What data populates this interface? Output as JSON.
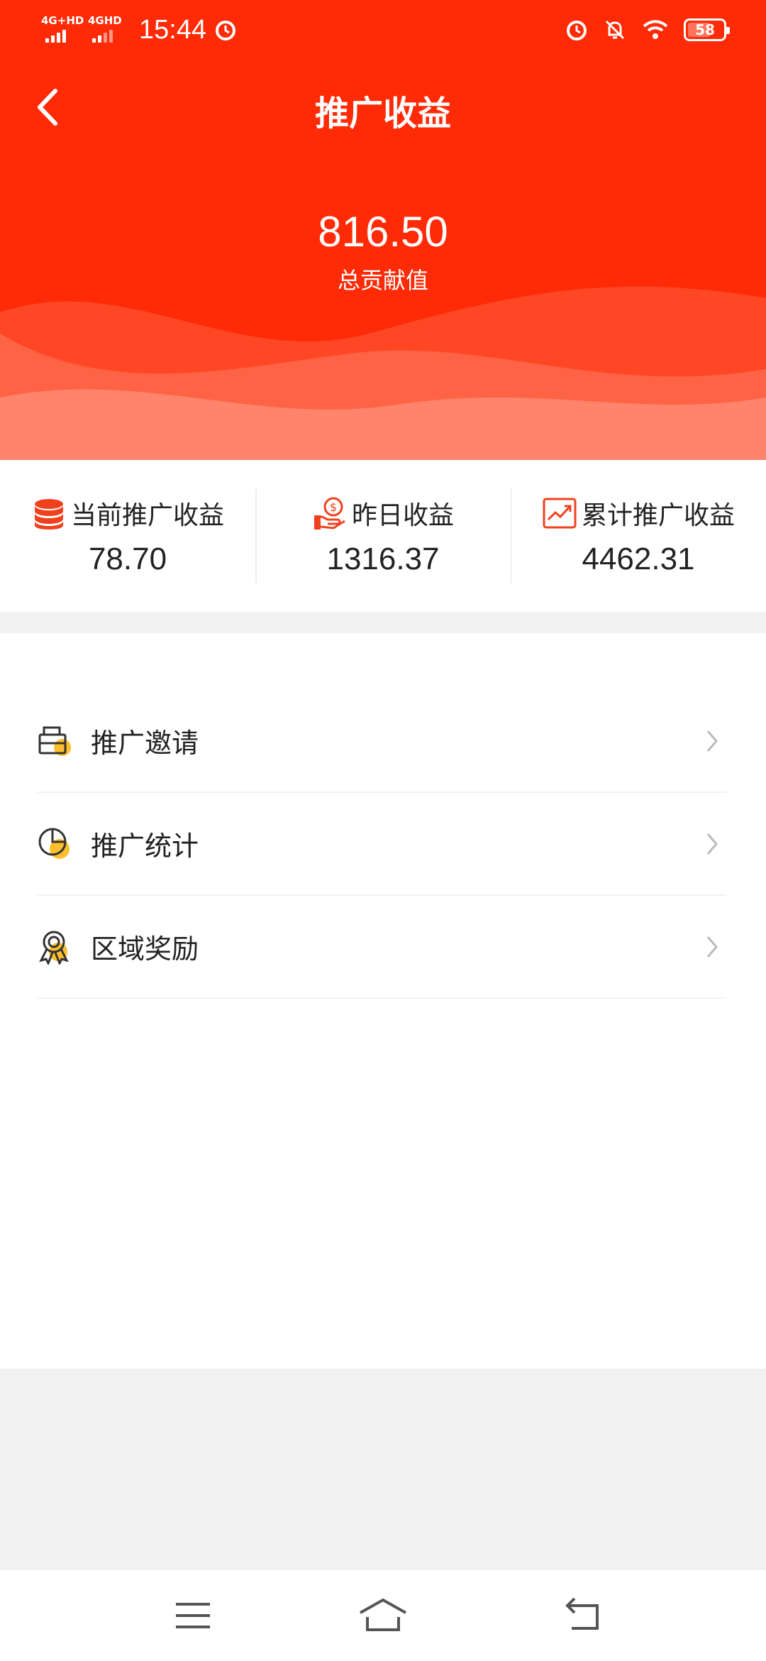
{
  "status_bar": {
    "network1": "4G+HD",
    "network2": "4GHD",
    "time": "15:44",
    "battery": "58",
    "battery_level": 0.58
  },
  "header": {
    "title": "推广收益",
    "total_value": "816.50",
    "total_label": "总贡献值"
  },
  "stats": [
    {
      "label": "当前推广收益",
      "value": "78.70",
      "icon": "coins-stack-icon"
    },
    {
      "label": "昨日收益",
      "value": "1316.37",
      "icon": "hand-coin-icon"
    },
    {
      "label": "累计推广收益",
      "value": "4462.31",
      "icon": "trend-chart-icon"
    }
  ],
  "menu": [
    {
      "label": "推广邀请",
      "icon": "envelope-icon"
    },
    {
      "label": "推广统计",
      "icon": "pie-chart-icon"
    },
    {
      "label": "区域奖励",
      "icon": "medal-icon"
    }
  ],
  "colors": {
    "brand_red": "#ff2a06",
    "accent_yellow": "#fdbf2d",
    "icon_red": "#f0411e"
  }
}
